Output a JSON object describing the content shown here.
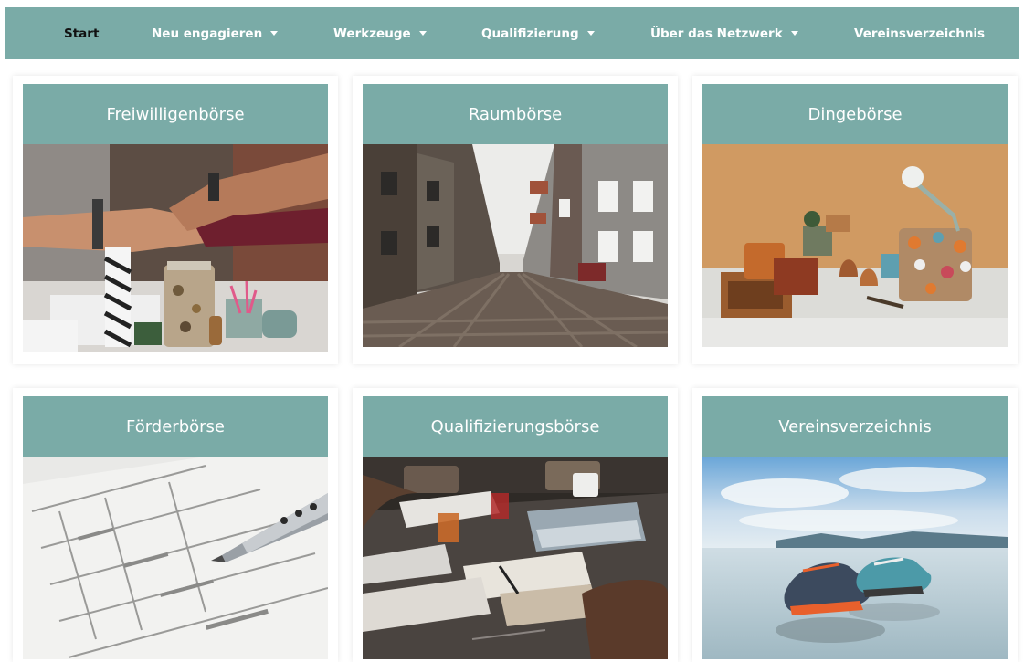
{
  "nav": {
    "items": [
      {
        "label": "Start",
        "active": true,
        "dropdown": false
      },
      {
        "label": "Neu engagieren",
        "active": false,
        "dropdown": true
      },
      {
        "label": "Werkzeuge",
        "active": false,
        "dropdown": true
      },
      {
        "label": "Qualifizierung",
        "active": false,
        "dropdown": true
      },
      {
        "label": "Über das Netzwerk",
        "active": false,
        "dropdown": true
      },
      {
        "label": "Vereinsverzeichnis",
        "active": false,
        "dropdown": false
      }
    ]
  },
  "cards": [
    {
      "title": "Freiwilligenbörse",
      "image": "teamwork-hands-photo"
    },
    {
      "title": "Raumbörse",
      "image": "cobblestone-street-photo"
    },
    {
      "title": "Dingebörse",
      "image": "collected-objects-photo"
    },
    {
      "title": "Förderbörse",
      "image": "form-and-pen-photo"
    },
    {
      "title": "Qualifizierungsbörse",
      "image": "meeting-table-photo"
    },
    {
      "title": "Vereinsverzeichnis",
      "image": "sneakers-on-beach-photo"
    }
  ],
  "colors": {
    "accent": "#7aaba7",
    "nav_text": "#ffffff",
    "nav_active_text": "#111111",
    "card_title_text": "#ffffff"
  }
}
